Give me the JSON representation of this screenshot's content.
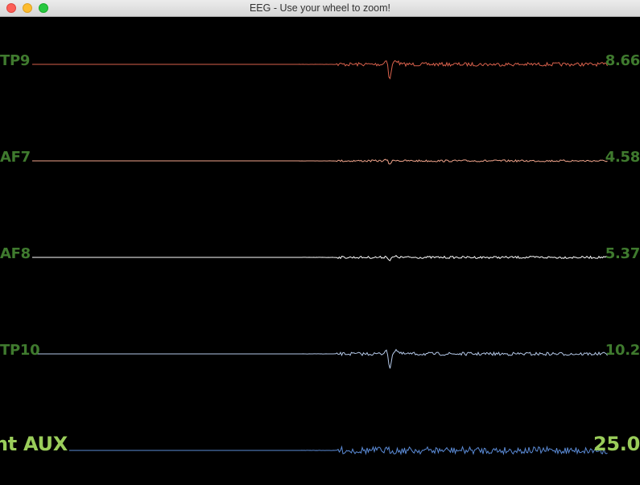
{
  "window": {
    "title": "EEG - Use your wheel to zoom!"
  },
  "channels": [
    {
      "label": "TP9",
      "value": "8.66",
      "color": "#d9614c"
    },
    {
      "label": "AF7",
      "value": "4.58",
      "color": "#f2a58c"
    },
    {
      "label": "AF8",
      "value": "5.37",
      "color": "#ffffff"
    },
    {
      "label": "TP10",
      "value": "10.2",
      "color": "#b4c8e8"
    },
    {
      "label": "nt AUX",
      "value": "25.0",
      "color": "#5b8bd6"
    }
  ]
}
